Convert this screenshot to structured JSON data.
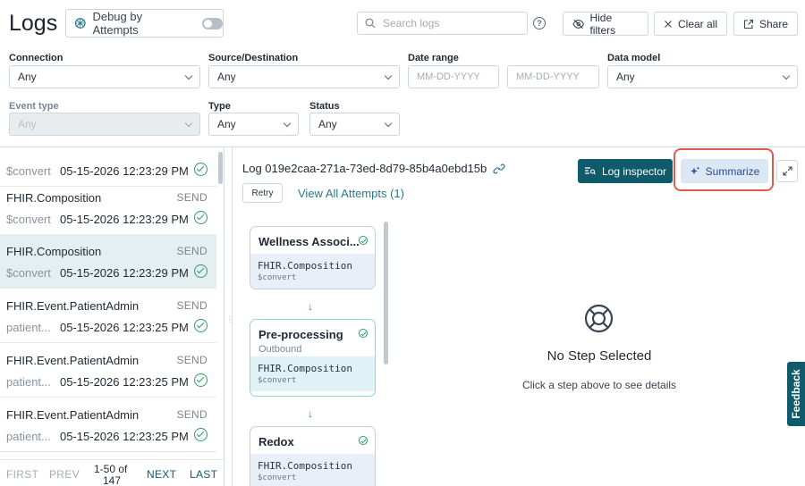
{
  "header": {
    "title": "Logs",
    "debug_label": "Debug by Attempts",
    "search_placeholder": "Search logs",
    "help_glyph": "?",
    "hide_filters": "Hide filters",
    "clear_all": "Clear all",
    "share": "Share"
  },
  "filters": {
    "connection": {
      "label": "Connection",
      "value": "Any"
    },
    "source_destination": {
      "label": "Source/Destination",
      "value": "Any"
    },
    "date_range": {
      "label": "Date range",
      "from_placeholder": "MM-DD-YYYY",
      "to_placeholder": "MM-DD-YYYY"
    },
    "data_model": {
      "label": "Data model",
      "value": "Any"
    },
    "event_type": {
      "label": "Event type",
      "value": "Any"
    },
    "type": {
      "label": "Type",
      "value": "Any"
    },
    "status": {
      "label": "Status",
      "value": "Any"
    }
  },
  "log_list": {
    "rows": [
      {
        "name": "",
        "tag": "",
        "sub": "$convert",
        "time": "05-15-2026 12:23:29 PM"
      },
      {
        "name": "FHIR.Composition",
        "tag": "SEND",
        "sub": "$convert",
        "time": "05-15-2026 12:23:29 PM"
      },
      {
        "name": "FHIR.Composition",
        "tag": "SEND",
        "sub": "$convert",
        "time": "05-15-2026 12:23:29 PM"
      },
      {
        "name": "FHIR.Event.PatientAdmin",
        "tag": "SEND",
        "sub": "patient...",
        "time": "05-15-2026 12:23:25 PM"
      },
      {
        "name": "FHIR.Event.PatientAdmin",
        "tag": "SEND",
        "sub": "patient...",
        "time": "05-15-2026 12:23:25 PM"
      },
      {
        "name": "FHIR.Event.PatientAdmin",
        "tag": "SEND",
        "sub": "patient...",
        "time": "05-15-2026 12:23:25 PM"
      }
    ],
    "selected_index": 2
  },
  "pager": {
    "first": "FIRST",
    "prev": "PREV",
    "range": "1-50 of",
    "total": "147",
    "next": "NEXT",
    "last": "LAST"
  },
  "detail": {
    "log_id": "Log 019e2caa-271a-73ed-8d79-85b4a0ebd15b",
    "retry": "Retry",
    "view_attempts": "View All Attempts (1)",
    "log_inspector": "Log inspector",
    "summarize": "Summarize",
    "steps": [
      {
        "name": "Wellness Associ...",
        "direction": "",
        "model": "FHIR.Composition",
        "op": "$convert"
      },
      {
        "name": "Pre-processing",
        "direction": "Outbound",
        "model": "FHIR.Composition",
        "op": "$convert"
      },
      {
        "name": "Redox",
        "direction": "",
        "model": "FHIR.Composition",
        "op": "$convert"
      }
    ],
    "arrow_glyph": "↓",
    "empty_title": "No Step Selected",
    "empty_subtitle": "Click a step above to see details"
  },
  "feedback": "Feedback",
  "colors": {
    "primary": "#0f5a6b",
    "link": "#2c7a8c",
    "success": "#2e9b68",
    "highlight": "#e05a4d",
    "selected_row": "#e5eff1"
  }
}
